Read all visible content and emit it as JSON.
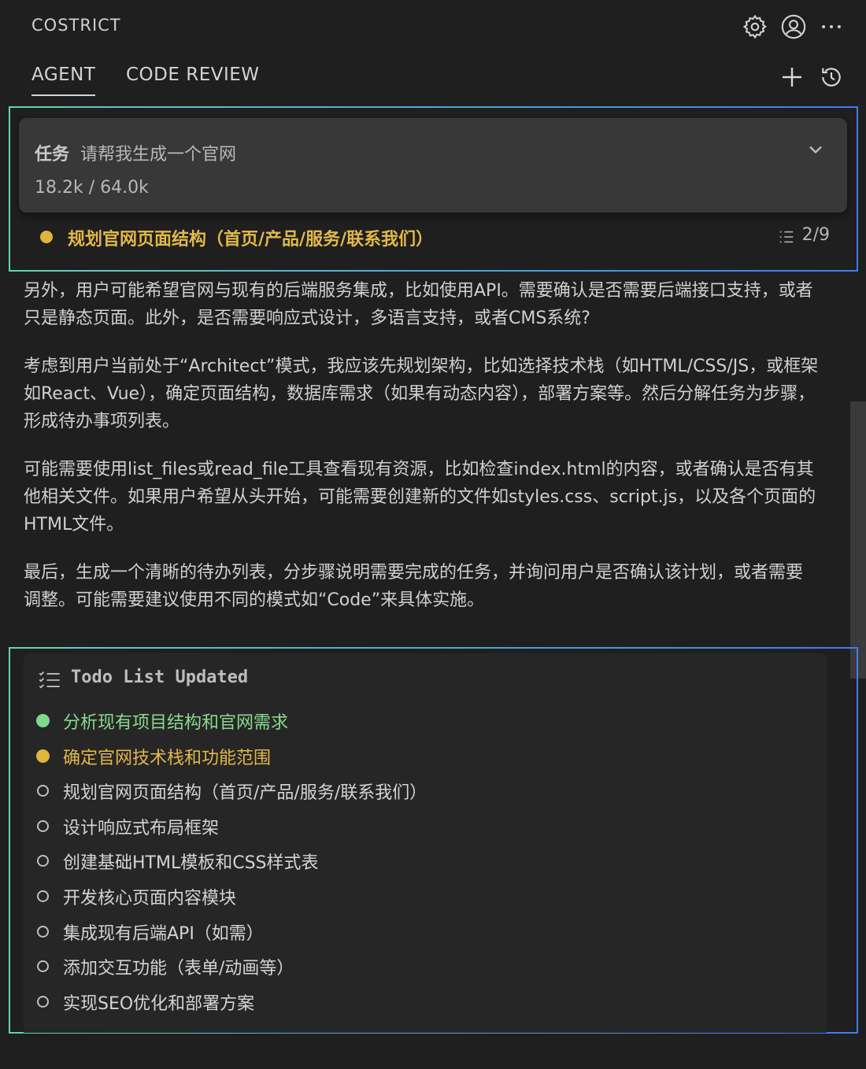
{
  "header": {
    "app_title": "COSTRICT",
    "icons": [
      "gear-icon",
      "account-icon",
      "more-icon"
    ]
  },
  "tabs": [
    {
      "label": "AGENT",
      "active": true
    },
    {
      "label": "CODE REVIEW",
      "active": false
    }
  ],
  "tab_actions": [
    "plus-icon",
    "history-icon"
  ],
  "task": {
    "label": "任务",
    "text": "请帮我生成一个官网",
    "tokens": "18.2k / 64.0k",
    "current_step": "规划官网页面结构（首页/产品/服务/联系我们）",
    "progress": "2/9"
  },
  "paragraphs": [
    "另外，用户可能希望官网与现有的后端服务集成，比如使用API。需要确认是否需要后端接口支持，或者只是静态页面。此外，是否需要响应式设计，多语言支持，或者CMS系统?",
    "考虑到用户当前处于“Architect”模式，我应该先规划架构，比如选择技术栈（如HTML/CSS/JS，或框架如React、Vue），确定页面结构，数据库需求（如果有动态内容），部署方案等。然后分解任务为步骤，形成待办事项列表。",
    "可能需要使用list_files或read_file工具查看现有资源，比如检查index.html的内容，或者确认是否有其他相关文件。如果用户希望从头开始，可能需要创建新的文件如styles.css、script.js，以及各个页面的HTML文件。",
    "最后，生成一个清晰的待办列表，分步骤说明需要完成的任务，并询问用户是否确认该计划，或者需要调整。可能需要建议使用不同的模式如“Code”来具体实施。"
  ],
  "todo": {
    "title": "Todo List Updated",
    "items": [
      {
        "text": "分析现有项目结构和官网需求",
        "status": "done"
      },
      {
        "text": "确定官网技术栈和功能范围",
        "status": "active"
      },
      {
        "text": "规划官网页面结构（首页/产品/服务/联系我们）",
        "status": "pending"
      },
      {
        "text": "设计响应式布局框架",
        "status": "pending"
      },
      {
        "text": "创建基础HTML模板和CSS样式表",
        "status": "pending"
      },
      {
        "text": "开发核心页面内容模块",
        "status": "pending"
      },
      {
        "text": "集成现有后端API（如需）",
        "status": "pending"
      },
      {
        "text": "添加交互功能（表单/动画等）",
        "status": "pending"
      },
      {
        "text": "实现SEO优化和部署方案",
        "status": "pending"
      }
    ]
  },
  "colors": {
    "background": "#1f1f1f",
    "done": "#7fd88a",
    "active": "#e0b53e",
    "outline_start": "#5fd5b4",
    "outline_end": "#3f7cf0"
  }
}
